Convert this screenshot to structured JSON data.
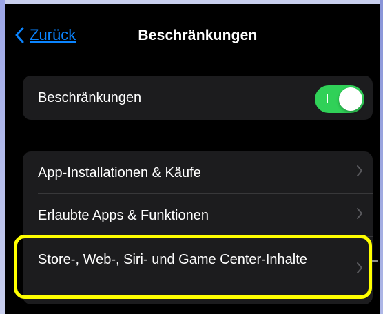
{
  "colors": {
    "accent": "#0a84ff",
    "toggle_on": "#30d158",
    "highlight": "#ffff00",
    "cell_background": "#1c1c1e"
  },
  "navbar": {
    "back_label": "Zurück",
    "back_icon": "chevron-left-icon",
    "title": "Beschränkungen"
  },
  "restrictions_toggle": {
    "label": "Beschränkungen",
    "state": "on"
  },
  "settings_list": {
    "items": [
      {
        "label": "App-Installationen & Käufe",
        "icon": "chevron-right-icon"
      },
      {
        "label": "Erlaubte Apps & Funktionen",
        "icon": "chevron-right-icon"
      },
      {
        "label": "Store-, Web-, Siri- und Game Center-Inhalte",
        "icon": "chevron-right-icon",
        "highlighted": true
      }
    ]
  }
}
